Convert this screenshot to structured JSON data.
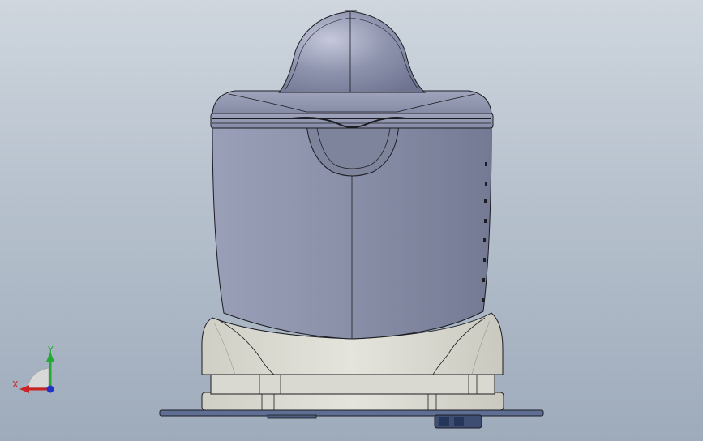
{
  "viewport": {
    "background_top": "#cfd6de",
    "background_bottom": "#9eabbb"
  },
  "model": {
    "body_color": "#8b90a9",
    "body_shadow": "#6f748d",
    "base_color": "#dcdcd4",
    "base_shadow": "#b8b8b0",
    "plate_color": "#5e6f93",
    "edge_color": "#1c1c22"
  },
  "triad": {
    "x_label": "X",
    "y_label": "Y",
    "x_color": "#cc2222",
    "y_color": "#22aa33",
    "z_color": "#2233cc"
  }
}
